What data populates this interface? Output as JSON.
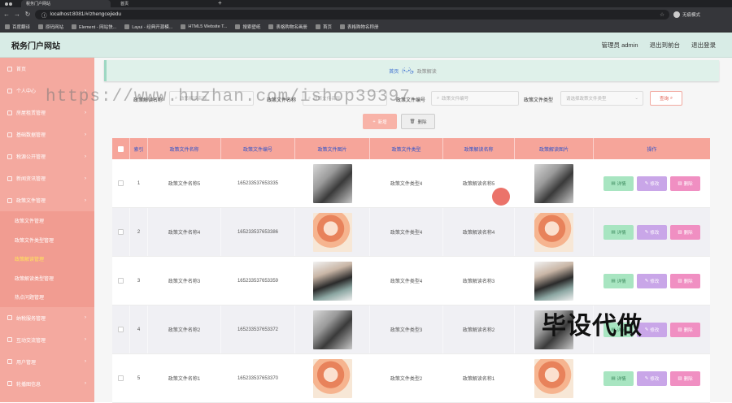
{
  "browser": {
    "tab_active": "税务门户网站",
    "tab_other": "首页",
    "url": "localhost:8081/#/zhengcejiedu",
    "profile": "无痕模式",
    "bookmarks": [
      "百度翻译",
      "原码网站",
      "Element - 网站快...",
      "Layui - 经典开源模...",
      "HTML5 Website T...",
      "搜索壁纸",
      "表格购物名画册",
      "首页",
      "表格购物名称册"
    ]
  },
  "header": {
    "brand": "税务门户网站",
    "admin": "管理员 admin",
    "back_front": "退出到前台",
    "logout": "退出登录"
  },
  "sidebar": {
    "items": [
      "首页",
      "个人中心",
      "房屋租赁管理",
      "基础数据管理",
      "税源公开管理",
      "新闻资讯管理",
      "政策文件管理"
    ],
    "sub_items": [
      "政策文件管理",
      "政策文件类型管理",
      "政策解读管理",
      "政策解读类型管理",
      "热点问题管理"
    ],
    "active_sub": "政策解读管理",
    "items_after": [
      "纳税服务管理",
      "互动交流管理",
      "用户管理",
      "轮播图信息"
    ]
  },
  "breadcrumb": {
    "home": "首页",
    "sep": "(•̀ᴗ•́)و",
    "current": "政策解读"
  },
  "search": {
    "label1": "政策解读名称",
    "placeholder1": "政策解读名称",
    "label2": "政策文件名称",
    "placeholder2": "政策文件名称",
    "label3": "政策文件编号",
    "placeholder3": "政策文件编号",
    "label4": "政策文件类型",
    "placeholder4": "请选择政策文件类型",
    "button": "查询"
  },
  "actions": {
    "add": "新增",
    "delete": "删除"
  },
  "table": {
    "headers": [
      "",
      "索引",
      "政策文件名称",
      "政策文件编号",
      "政策文件图片",
      "政策文件类型",
      "政策解读名称",
      "政策解读图片",
      "操作"
    ],
    "rows": [
      {
        "idx": "1",
        "name": "政策文件名称5",
        "code": "165233537653335",
        "type": "政策文件类型4",
        "iname": "政策解读名称5",
        "img": "a"
      },
      {
        "idx": "2",
        "name": "政策文件名称4",
        "code": "165233537653386",
        "type": "政策文件类型4",
        "iname": "政策解读名称4",
        "img": "b"
      },
      {
        "idx": "3",
        "name": "政策文件名称3",
        "code": "165233537653359",
        "type": "政策文件类型4",
        "iname": "政策解读名称3",
        "img": "c"
      },
      {
        "idx": "4",
        "name": "政策文件名称2",
        "code": "165233537653372",
        "type": "政策文件类型3",
        "iname": "政策解读名称2",
        "img": "a"
      },
      {
        "idx": "5",
        "name": "政策文件名称1",
        "code": "165233537653370",
        "type": "政策文件类型2",
        "iname": "政策解读名称1",
        "img": "b"
      }
    ],
    "op_detail": "详情",
    "op_edit": "修改",
    "op_delete": "删除"
  },
  "overlay": {
    "watermark": "https://www.huzhan.com/ishop39397",
    "stamp": "毕设代做"
  }
}
